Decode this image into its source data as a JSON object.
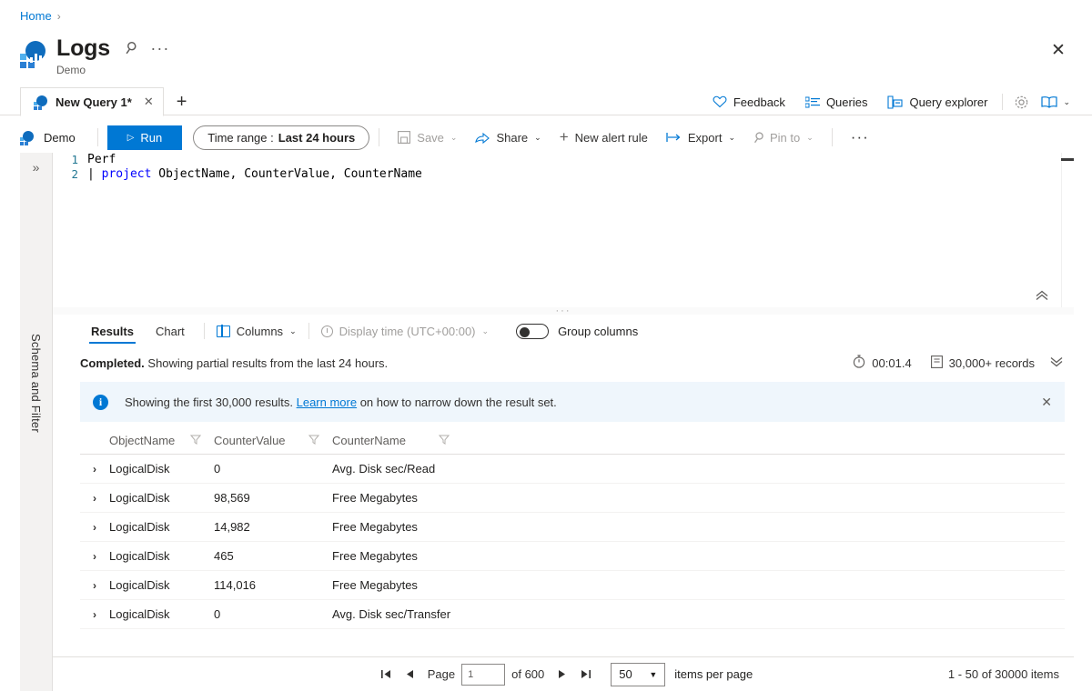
{
  "breadcrumb": {
    "home": "Home",
    "separator": "›"
  },
  "header": {
    "title": "Logs",
    "subtitle": "Demo",
    "pin_icon": "pin-icon",
    "more_icon": "ellipsis-icon",
    "close_icon": "close-icon",
    "accent": "#0078d4"
  },
  "tabs": {
    "items": [
      {
        "label": "New Query 1*",
        "close": "✕"
      }
    ],
    "add_label": "+"
  },
  "top_commands": {
    "feedback": "Feedback",
    "queries": "Queries",
    "query_explorer": "Query explorer",
    "settings_icon": "gear-icon",
    "help_icon": "book-icon",
    "chevron": "⌄"
  },
  "query_bar": {
    "scope": "Demo",
    "run": "Run",
    "run_icon": "play-icon",
    "time_range_label": "Time range :",
    "time_range_value": "Last 24 hours",
    "save": "Save",
    "share": "Share",
    "new_alert_rule": "New alert rule",
    "export": "Export",
    "pin_to": "Pin to",
    "more": "···",
    "chevron": "⌄"
  },
  "rail": {
    "expand_icon": "»",
    "label": "Schema and Filter"
  },
  "editor": {
    "lines": [
      {
        "number": "1",
        "text": "Perf",
        "kind": "plain"
      },
      {
        "number": "2",
        "text": "| project ObjectName, CounterValue, CounterName",
        "kind": "pipe"
      }
    ],
    "line1_number": "1",
    "line2_number": "2",
    "line1_text": "Perf",
    "line2_pipe": "| ",
    "line2_keyword": "project",
    "line2_rest": " ObjectName, CounterValue, CounterName",
    "collapse_icon": "chevron-double-up-icon"
  },
  "results": {
    "tab_results": "Results",
    "tab_chart": "Chart",
    "columns_label": "Columns",
    "display_time_label": "Display time (UTC+00:00)",
    "group_columns_label": "Group columns",
    "group_columns_on": false,
    "chevron": "⌄"
  },
  "status": {
    "state": "Completed.",
    "message": " Showing partial results from the last 24 hours.",
    "duration": "00:01.4",
    "records": "30,000+ records",
    "expand_icon": "⌄⌄"
  },
  "banner": {
    "info_icon": "i",
    "text_before": "Showing the first 30,000 results. ",
    "link": "Learn more",
    "text_after": " on how to narrow down the result set.",
    "close": "✕",
    "background": "#eff6fc"
  },
  "grid": {
    "columns": [
      "ObjectName",
      "CounterValue",
      "CounterName"
    ],
    "filter_icon": "filter-funnel-icon",
    "expand_icon": "›",
    "rows": [
      {
        "ObjectName": "LogicalDisk",
        "CounterValue": "0",
        "CounterName": "Avg. Disk sec/Read"
      },
      {
        "ObjectName": "LogicalDisk",
        "CounterValue": "98,569",
        "CounterName": "Free Megabytes"
      },
      {
        "ObjectName": "LogicalDisk",
        "CounterValue": "14,982",
        "CounterName": "Free Megabytes"
      },
      {
        "ObjectName": "LogicalDisk",
        "CounterValue": "465",
        "CounterName": "Free Megabytes"
      },
      {
        "ObjectName": "LogicalDisk",
        "CounterValue": "114,016",
        "CounterName": "Free Megabytes"
      },
      {
        "ObjectName": "LogicalDisk",
        "CounterValue": "0",
        "CounterName": "Avg. Disk sec/Transfer"
      }
    ]
  },
  "pager": {
    "first": "◀|",
    "prev": "◀",
    "page_label": "Page",
    "page_value": "1",
    "of_label": "of 600",
    "next": "▶",
    "last": "|▶",
    "page_size": "50",
    "items_per_page": "items per page",
    "range_text": "1 - 50 of 30000 items"
  }
}
